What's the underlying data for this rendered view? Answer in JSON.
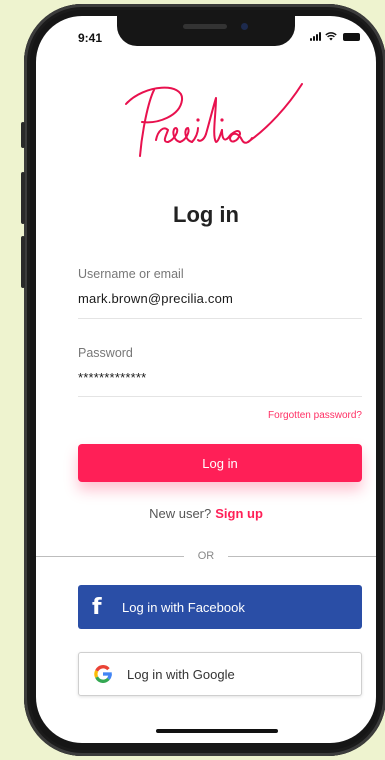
{
  "status_bar": {
    "time": "9:41"
  },
  "brand": {
    "logo_text": "Precilia",
    "accent_color": "#ff1f57"
  },
  "page_title": "Log in",
  "form": {
    "username": {
      "label": "Username or email",
      "value": "mark.brown@precilia.com"
    },
    "password": {
      "label": "Password",
      "value": "*************"
    },
    "forgot_link": "Forgotten password?",
    "submit_label": "Log in"
  },
  "signup": {
    "prompt": "New user?",
    "link": "Sign up"
  },
  "divider": {
    "text": "OR"
  },
  "social": {
    "facebook": {
      "label": "Log in with Facebook",
      "icon": "facebook-icon",
      "color": "#2a4ea6"
    },
    "google": {
      "label": "Log in with Google",
      "icon": "google-icon"
    }
  }
}
